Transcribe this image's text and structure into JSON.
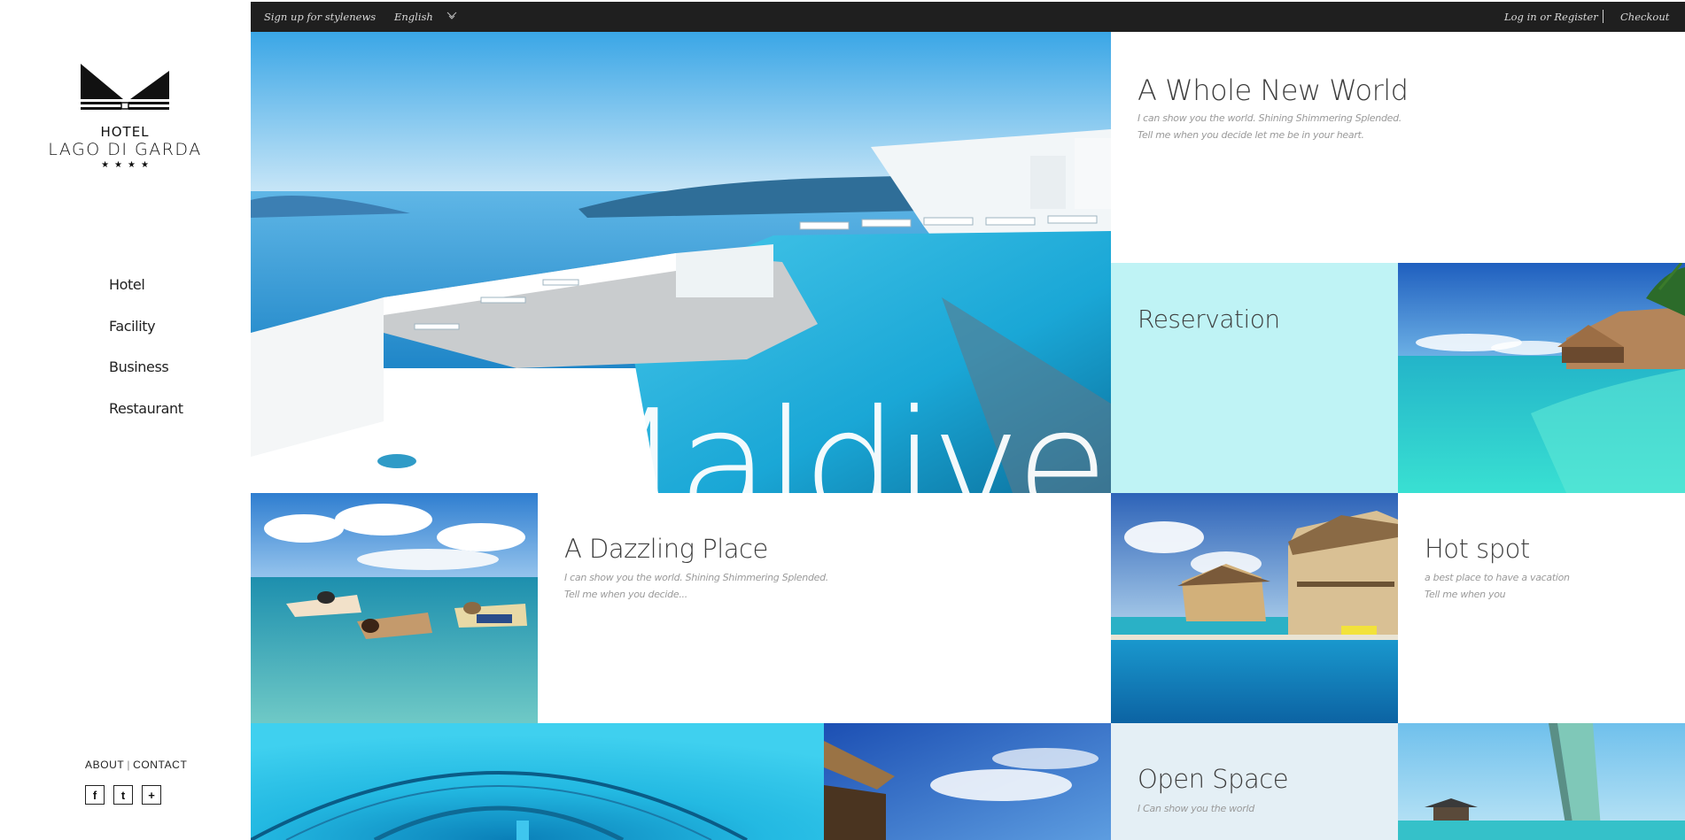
{
  "brand": {
    "hotel_word": "HOTEL",
    "hotel_name": "LAGO DI GARDA",
    "stars": "★★★★"
  },
  "nav": {
    "items": [
      "Hotel",
      "Facility",
      "Business",
      "Restaurant"
    ]
  },
  "footer": {
    "about": "ABOUT",
    "contact": "CONTACT",
    "social": [
      "f",
      "t",
      "+"
    ]
  },
  "topbar": {
    "newsletter": "Sign up for stylenews",
    "language": "English",
    "login": "Log in or Register",
    "checkout": "Checkout"
  },
  "hero": {
    "word": "Maldives"
  },
  "tiles": {
    "whole_new_world": {
      "title": "A Whole New World",
      "line1": "I can show you the world. Shining Shimmering Splended.",
      "line2": "Tell me when you decide let me be in your heart."
    },
    "reservation": {
      "title": "Reservation"
    },
    "dazzling": {
      "title": "A Dazzling Place",
      "line1": "I can show you the world. Shining Shimmering Splended.",
      "line2": "Tell me when you decide..."
    },
    "hot_spot": {
      "title": "Hot spot",
      "line1": "a best place to have a vacation",
      "line2": "Tell me when you"
    },
    "open_space": {
      "title": "Open Space",
      "line1": "I Can show you the world"
    }
  },
  "colors": {
    "topbar": "#1f1f1f",
    "reservation_bg": "#bff3f5",
    "open_space_bg": "#e4eff5",
    "lagoon": "#2fc7d8"
  }
}
